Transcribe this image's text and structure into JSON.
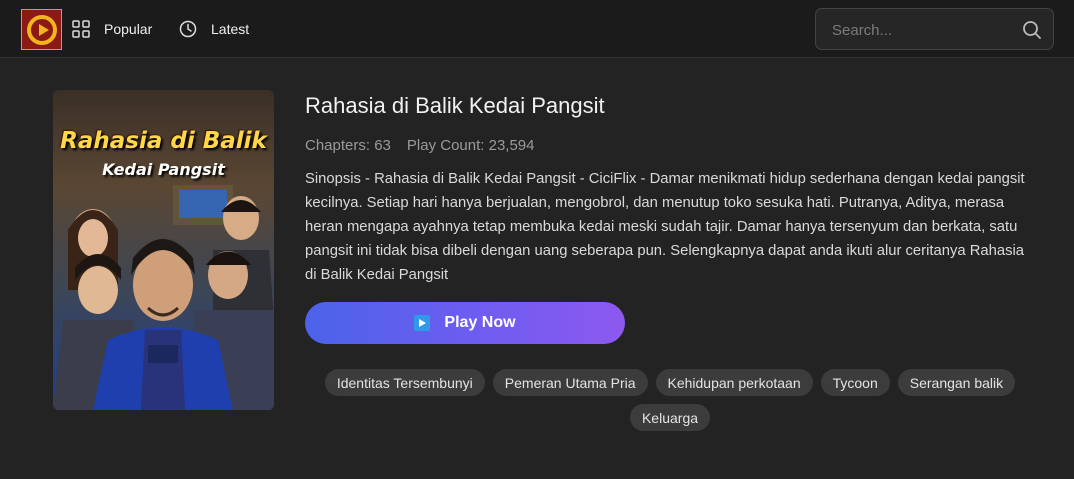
{
  "header": {
    "logo_icon": "play-logo-icon",
    "nav": [
      {
        "label": "Popular",
        "icon": "grid-icon"
      },
      {
        "label": "Latest",
        "icon": "clock-icon"
      }
    ],
    "search": {
      "placeholder": "Search...",
      "icon": "search-icon"
    }
  },
  "drama": {
    "title": "Rahasia di Balik Kedai Pangsit",
    "poster_title": "Rahasia di Balik",
    "poster_subtitle": "Kedai Pangsit",
    "chapters": "Chapters: 63",
    "play_count": "Play Count: 23,594",
    "synopsis": "Sinopsis - Rahasia di Balik Kedai Pangsit - CiciFlix - Damar menikmati hidup sederhana dengan kedai pangsit kecilnya. Setiap hari hanya berjualan, mengobrol, dan menutup toko sesuka hati. Putranya, Aditya, merasa heran mengapa ayahnya tetap membuka kedai meski sudah tajir. Damar hanya tersenyum dan berkata, satu pangsit ini tidak bisa dibeli dengan uang seberapa pun. Selengkapnya dapat anda ikuti alur ceritanya Rahasia di Balik Kedai Pangsit",
    "play_button": "Play Now",
    "tags": [
      "Identitas Tersembunyi",
      "Pemeran Utama Pria",
      "Kehidupan perkotaan",
      "Tycoon",
      "Serangan balik",
      "Keluarga"
    ]
  },
  "colors": {
    "background": "#232323",
    "header": "#1b1b1b",
    "accent_start": "#4b63ea",
    "accent_end": "#8d59ef",
    "tag_bg": "#3c3c3c"
  }
}
